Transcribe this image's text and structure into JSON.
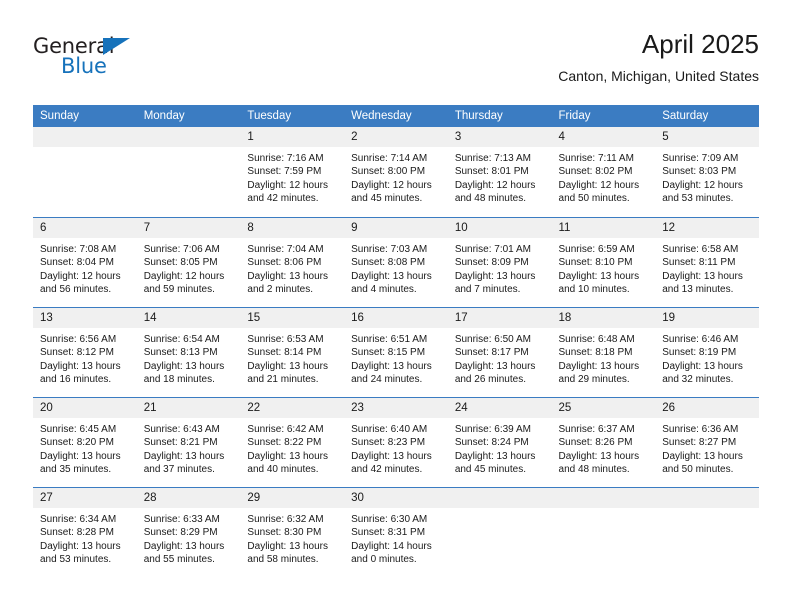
{
  "brand": {
    "name_part1": "General",
    "name_part2": "Blue",
    "triangle_icon": "triangle-icon",
    "color_dark": "#231f20",
    "color_blue": "#1672bb"
  },
  "header": {
    "title": "April 2025",
    "subtitle": "Canton, Michigan, United States"
  },
  "theme": {
    "header_bg": "#3b7cc2",
    "header_text": "#ffffff",
    "daynum_bg": "#f0f0f0",
    "cell_bg": "#ffffff",
    "rule_color": "#3b7cc2"
  },
  "weekdays": [
    "Sunday",
    "Monday",
    "Tuesday",
    "Wednesday",
    "Thursday",
    "Friday",
    "Saturday"
  ],
  "weeks": [
    [
      {
        "day": "",
        "sunrise": "",
        "sunset": "",
        "daylight_1": "",
        "daylight_2": ""
      },
      {
        "day": "",
        "sunrise": "",
        "sunset": "",
        "daylight_1": "",
        "daylight_2": ""
      },
      {
        "day": "1",
        "sunrise": "Sunrise: 7:16 AM",
        "sunset": "Sunset: 7:59 PM",
        "daylight_1": "Daylight: 12 hours",
        "daylight_2": "and 42 minutes."
      },
      {
        "day": "2",
        "sunrise": "Sunrise: 7:14 AM",
        "sunset": "Sunset: 8:00 PM",
        "daylight_1": "Daylight: 12 hours",
        "daylight_2": "and 45 minutes."
      },
      {
        "day": "3",
        "sunrise": "Sunrise: 7:13 AM",
        "sunset": "Sunset: 8:01 PM",
        "daylight_1": "Daylight: 12 hours",
        "daylight_2": "and 48 minutes."
      },
      {
        "day": "4",
        "sunrise": "Sunrise: 7:11 AM",
        "sunset": "Sunset: 8:02 PM",
        "daylight_1": "Daylight: 12 hours",
        "daylight_2": "and 50 minutes."
      },
      {
        "day": "5",
        "sunrise": "Sunrise: 7:09 AM",
        "sunset": "Sunset: 8:03 PM",
        "daylight_1": "Daylight: 12 hours",
        "daylight_2": "and 53 minutes."
      }
    ],
    [
      {
        "day": "6",
        "sunrise": "Sunrise: 7:08 AM",
        "sunset": "Sunset: 8:04 PM",
        "daylight_1": "Daylight: 12 hours",
        "daylight_2": "and 56 minutes."
      },
      {
        "day": "7",
        "sunrise": "Sunrise: 7:06 AM",
        "sunset": "Sunset: 8:05 PM",
        "daylight_1": "Daylight: 12 hours",
        "daylight_2": "and 59 minutes."
      },
      {
        "day": "8",
        "sunrise": "Sunrise: 7:04 AM",
        "sunset": "Sunset: 8:06 PM",
        "daylight_1": "Daylight: 13 hours",
        "daylight_2": "and 2 minutes."
      },
      {
        "day": "9",
        "sunrise": "Sunrise: 7:03 AM",
        "sunset": "Sunset: 8:08 PM",
        "daylight_1": "Daylight: 13 hours",
        "daylight_2": "and 4 minutes."
      },
      {
        "day": "10",
        "sunrise": "Sunrise: 7:01 AM",
        "sunset": "Sunset: 8:09 PM",
        "daylight_1": "Daylight: 13 hours",
        "daylight_2": "and 7 minutes."
      },
      {
        "day": "11",
        "sunrise": "Sunrise: 6:59 AM",
        "sunset": "Sunset: 8:10 PM",
        "daylight_1": "Daylight: 13 hours",
        "daylight_2": "and 10 minutes."
      },
      {
        "day": "12",
        "sunrise": "Sunrise: 6:58 AM",
        "sunset": "Sunset: 8:11 PM",
        "daylight_1": "Daylight: 13 hours",
        "daylight_2": "and 13 minutes."
      }
    ],
    [
      {
        "day": "13",
        "sunrise": "Sunrise: 6:56 AM",
        "sunset": "Sunset: 8:12 PM",
        "daylight_1": "Daylight: 13 hours",
        "daylight_2": "and 16 minutes."
      },
      {
        "day": "14",
        "sunrise": "Sunrise: 6:54 AM",
        "sunset": "Sunset: 8:13 PM",
        "daylight_1": "Daylight: 13 hours",
        "daylight_2": "and 18 minutes."
      },
      {
        "day": "15",
        "sunrise": "Sunrise: 6:53 AM",
        "sunset": "Sunset: 8:14 PM",
        "daylight_1": "Daylight: 13 hours",
        "daylight_2": "and 21 minutes."
      },
      {
        "day": "16",
        "sunrise": "Sunrise: 6:51 AM",
        "sunset": "Sunset: 8:15 PM",
        "daylight_1": "Daylight: 13 hours",
        "daylight_2": "and 24 minutes."
      },
      {
        "day": "17",
        "sunrise": "Sunrise: 6:50 AM",
        "sunset": "Sunset: 8:17 PM",
        "daylight_1": "Daylight: 13 hours",
        "daylight_2": "and 26 minutes."
      },
      {
        "day": "18",
        "sunrise": "Sunrise: 6:48 AM",
        "sunset": "Sunset: 8:18 PM",
        "daylight_1": "Daylight: 13 hours",
        "daylight_2": "and 29 minutes."
      },
      {
        "day": "19",
        "sunrise": "Sunrise: 6:46 AM",
        "sunset": "Sunset: 8:19 PM",
        "daylight_1": "Daylight: 13 hours",
        "daylight_2": "and 32 minutes."
      }
    ],
    [
      {
        "day": "20",
        "sunrise": "Sunrise: 6:45 AM",
        "sunset": "Sunset: 8:20 PM",
        "daylight_1": "Daylight: 13 hours",
        "daylight_2": "and 35 minutes."
      },
      {
        "day": "21",
        "sunrise": "Sunrise: 6:43 AM",
        "sunset": "Sunset: 8:21 PM",
        "daylight_1": "Daylight: 13 hours",
        "daylight_2": "and 37 minutes."
      },
      {
        "day": "22",
        "sunrise": "Sunrise: 6:42 AM",
        "sunset": "Sunset: 8:22 PM",
        "daylight_1": "Daylight: 13 hours",
        "daylight_2": "and 40 minutes."
      },
      {
        "day": "23",
        "sunrise": "Sunrise: 6:40 AM",
        "sunset": "Sunset: 8:23 PM",
        "daylight_1": "Daylight: 13 hours",
        "daylight_2": "and 42 minutes."
      },
      {
        "day": "24",
        "sunrise": "Sunrise: 6:39 AM",
        "sunset": "Sunset: 8:24 PM",
        "daylight_1": "Daylight: 13 hours",
        "daylight_2": "and 45 minutes."
      },
      {
        "day": "25",
        "sunrise": "Sunrise: 6:37 AM",
        "sunset": "Sunset: 8:26 PM",
        "daylight_1": "Daylight: 13 hours",
        "daylight_2": "and 48 minutes."
      },
      {
        "day": "26",
        "sunrise": "Sunrise: 6:36 AM",
        "sunset": "Sunset: 8:27 PM",
        "daylight_1": "Daylight: 13 hours",
        "daylight_2": "and 50 minutes."
      }
    ],
    [
      {
        "day": "27",
        "sunrise": "Sunrise: 6:34 AM",
        "sunset": "Sunset: 8:28 PM",
        "daylight_1": "Daylight: 13 hours",
        "daylight_2": "and 53 minutes."
      },
      {
        "day": "28",
        "sunrise": "Sunrise: 6:33 AM",
        "sunset": "Sunset: 8:29 PM",
        "daylight_1": "Daylight: 13 hours",
        "daylight_2": "and 55 minutes."
      },
      {
        "day": "29",
        "sunrise": "Sunrise: 6:32 AM",
        "sunset": "Sunset: 8:30 PM",
        "daylight_1": "Daylight: 13 hours",
        "daylight_2": "and 58 minutes."
      },
      {
        "day": "30",
        "sunrise": "Sunrise: 6:30 AM",
        "sunset": "Sunset: 8:31 PM",
        "daylight_1": "Daylight: 14 hours",
        "daylight_2": "and 0 minutes."
      },
      {
        "day": "",
        "sunrise": "",
        "sunset": "",
        "daylight_1": "",
        "daylight_2": ""
      },
      {
        "day": "",
        "sunrise": "",
        "sunset": "",
        "daylight_1": "",
        "daylight_2": ""
      },
      {
        "day": "",
        "sunrise": "",
        "sunset": "",
        "daylight_1": "",
        "daylight_2": ""
      }
    ]
  ]
}
